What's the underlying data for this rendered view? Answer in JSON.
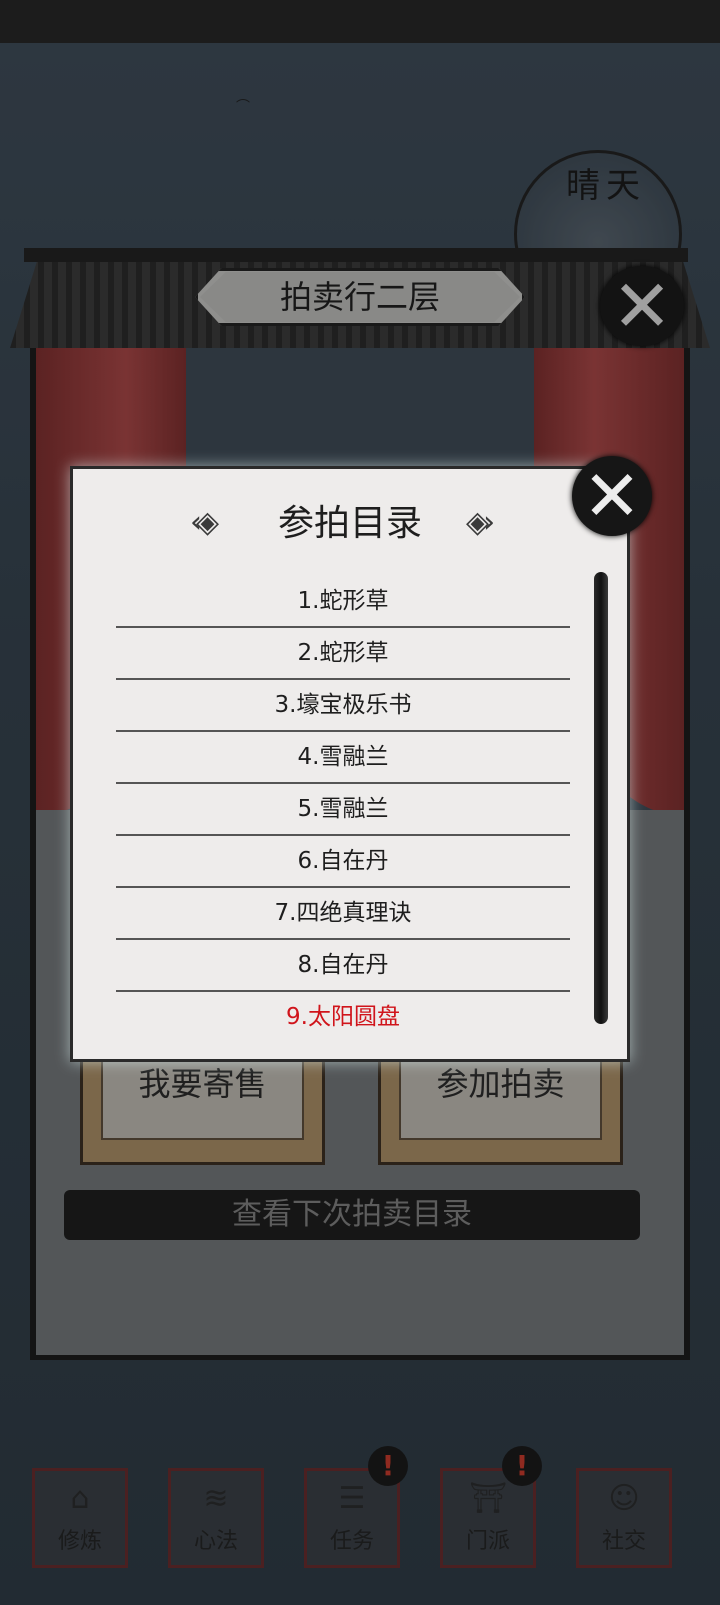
{
  "weather": "晴天",
  "hall": {
    "title": "拍卖行二层",
    "buttons": {
      "consign": "我要寄售",
      "join": "参加拍卖"
    },
    "next_catalog": "查看下次拍卖目录"
  },
  "popup": {
    "title": "参拍目录",
    "items": [
      "1.蛇形草",
      "2.蛇形草",
      "3.壕宝极乐书",
      "4.雪融兰",
      "5.雪融兰",
      "6.自在丹",
      "7.四绝真理诀",
      "8.自在丹",
      "9.太阳圆盘"
    ],
    "highlight_color": "#d0141b"
  },
  "nav": [
    {
      "label": "修炼",
      "icon": "cultivate-icon"
    },
    {
      "label": "心法",
      "icon": "scroll-icon"
    },
    {
      "label": "任务",
      "icon": "task-icon"
    },
    {
      "label": "门派",
      "icon": "sect-icon"
    },
    {
      "label": "社交",
      "icon": "social-icon"
    }
  ],
  "badges": [
    "!",
    "!"
  ]
}
